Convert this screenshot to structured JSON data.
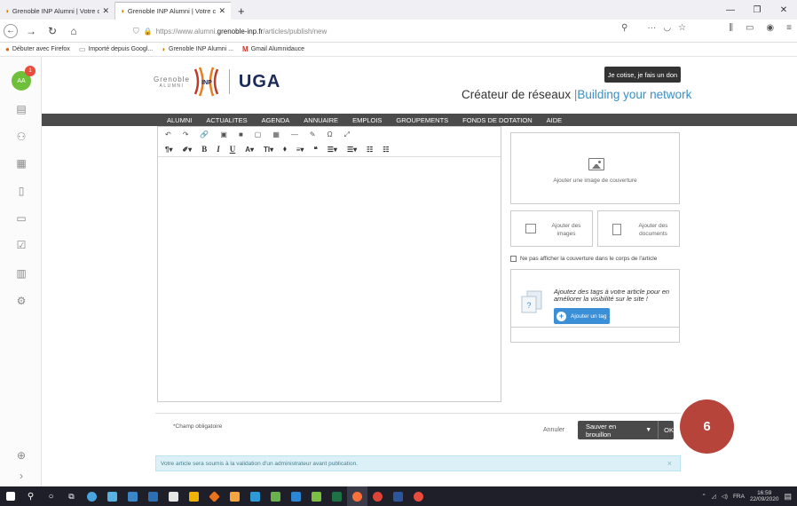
{
  "browser": {
    "tabs": [
      {
        "label": "Grenoble INP Alumni | Votre co",
        "active": false
      },
      {
        "label": "Grenoble INP Alumni | Votre co",
        "active": true
      }
    ],
    "url_prefix": "https://www.alumni.",
    "url_domain": "grenoble-inp.fr",
    "url_path": "/articles/publish/new",
    "bookmarks": [
      "Débuter avec Firefox",
      "Importé depuis Googl...",
      "Grenoble INP Alumni ...",
      "Gmail Alumnidauce"
    ]
  },
  "sidebar": {
    "avatar_initials": "AA",
    "badge_count": "1",
    "icons": [
      "id-card-icon",
      "group-icon",
      "calendar-icon",
      "document-icon",
      "card-icon",
      "check-icon",
      "building-icon",
      "network-icon"
    ]
  },
  "header": {
    "logo_grenoble": "Grenoble",
    "logo_inp": "INP",
    "logo_alumni": "ALUMNI",
    "logo_uga": "UGA",
    "cta": "Je cotise, je fais un don",
    "tagline_fr": "Créateur de réseaux",
    "tagline_pipe": "|",
    "tagline_en": "Building your network"
  },
  "nav": [
    "ALUMNI",
    "ACTUALITES",
    "AGENDA",
    "ANNUAIRE",
    "EMPLOIS",
    "GROUPEMENTS",
    "FONDS DE DOTATION",
    "AIDE"
  ],
  "editor": {
    "toolbar1": [
      "↶",
      "↷",
      "🔗",
      "▣",
      "■",
      "▢",
      "▦",
      "—",
      "✎",
      "Ω",
      "⤢"
    ],
    "toolbar2": [
      "¶▾",
      "✐▾",
      "B",
      "I",
      "U",
      "A▾",
      "TI▾",
      "⬧",
      "≡▾",
      "❝",
      "☰▾",
      "☰▾",
      "☷",
      "☷"
    ]
  },
  "panel": {
    "cover_label": "Ajouter une image de couverture",
    "add_images_1": "Ajouter des",
    "add_images_2": "images",
    "add_docs_1": "Ajouter des",
    "add_docs_2": "documents",
    "hide_cover": "Ne pas afficher la couverture dans le corps de l'article",
    "tags_text": "Ajoutez des tags à votre article pour en améliorer la visibilité sur le site !",
    "add_tag": "Ajouter un tag"
  },
  "footer": {
    "required": "*Champ obligatoire",
    "cancel": "Annuler",
    "save": "Sauver en brouillon",
    "ok": "OK",
    "step": "6",
    "notice": "Votre article sera soumis à la validation d'un administrateur avant publication.",
    "notice_close": "×"
  },
  "taskbar": {
    "lang": "FRA",
    "time": "16:59",
    "date": "22/09/2020"
  },
  "colors": {
    "nav_bg": "#4b4b4b",
    "accent_blue": "#3a8fc4",
    "step_red": "#b7443a",
    "notice_bg": "#dbf1f7"
  }
}
